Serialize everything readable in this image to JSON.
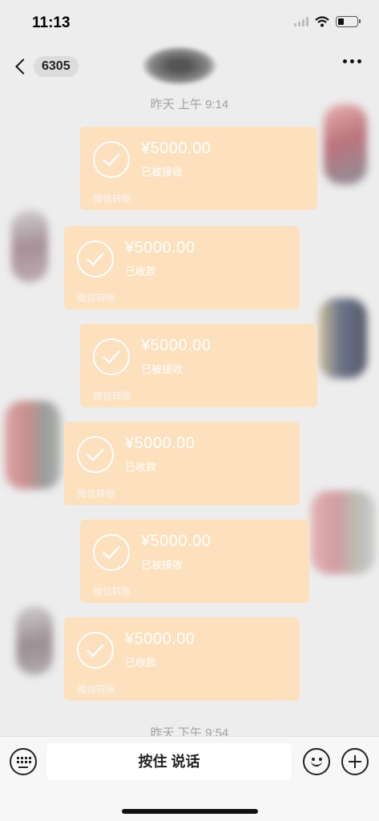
{
  "status_bar": {
    "time": "11:13"
  },
  "nav": {
    "unread_count": "6305"
  },
  "timestamps": {
    "top": "昨天 上午 9:14",
    "bottom": "昨天 下午 9:54"
  },
  "cards": [
    {
      "amount": "¥5000.00",
      "state": "已被接收",
      "label": "微信转账"
    },
    {
      "amount": "¥5000.00",
      "state": "已收款",
      "label": "微信转账"
    },
    {
      "amount": "¥5000.00",
      "state": "已被接收",
      "label": "微信转账"
    },
    {
      "amount": "¥5000.00",
      "state": "已收款",
      "label": "微信转账"
    },
    {
      "amount": "¥5000.00",
      "state": "已被接收",
      "label": "微信转账"
    },
    {
      "amount": "¥5000.00",
      "state": "已收款",
      "label": "微信转账"
    }
  ],
  "input": {
    "hold_to_talk": "按住 说话"
  },
  "colors": {
    "card_bg": "#fde0bd",
    "chat_bg": "#ededed"
  }
}
